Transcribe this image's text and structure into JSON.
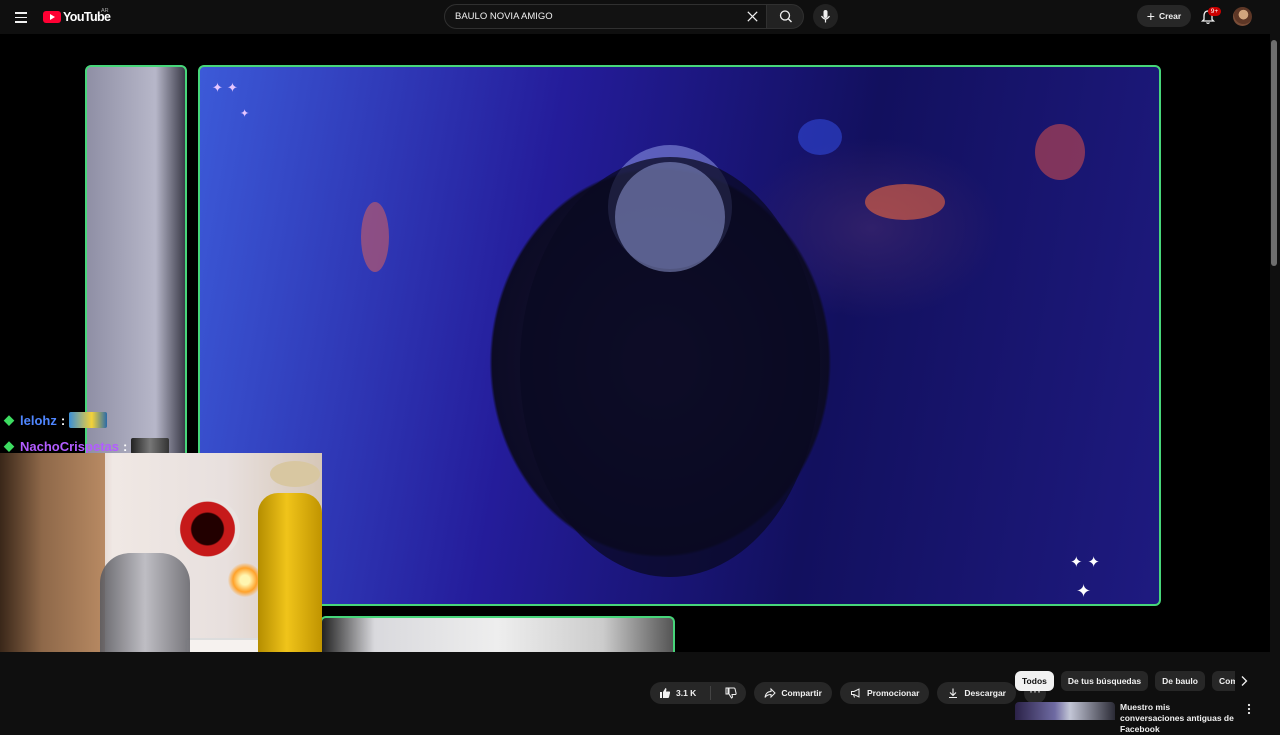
{
  "header": {
    "logo_text": "YouTube",
    "region": "AR",
    "search_value": "BAULO NOVIA AMIGO",
    "create_label": "Crear",
    "notification_count": "9+"
  },
  "video": {
    "chat": [
      {
        "user": "lelohz",
        "color": "#4f86ff"
      },
      {
        "user": "NachoCrispetas",
        "color": "#b25cff"
      }
    ],
    "chat_separator": ":"
  },
  "actions": {
    "like_count": "3.1 K",
    "share_label": "Compartir",
    "promote_label": "Promocionar",
    "download_label": "Descargar"
  },
  "chips": [
    "Todos",
    "De tus búsquedas",
    "De baulo",
    "Comentarios"
  ],
  "recommendation": {
    "title": "Muestro mis conversaciones antiguas de Facebook"
  },
  "colors": {
    "brand": "#ff0033",
    "stream_border": "#47d67a",
    "background": "#0f0f0f"
  }
}
